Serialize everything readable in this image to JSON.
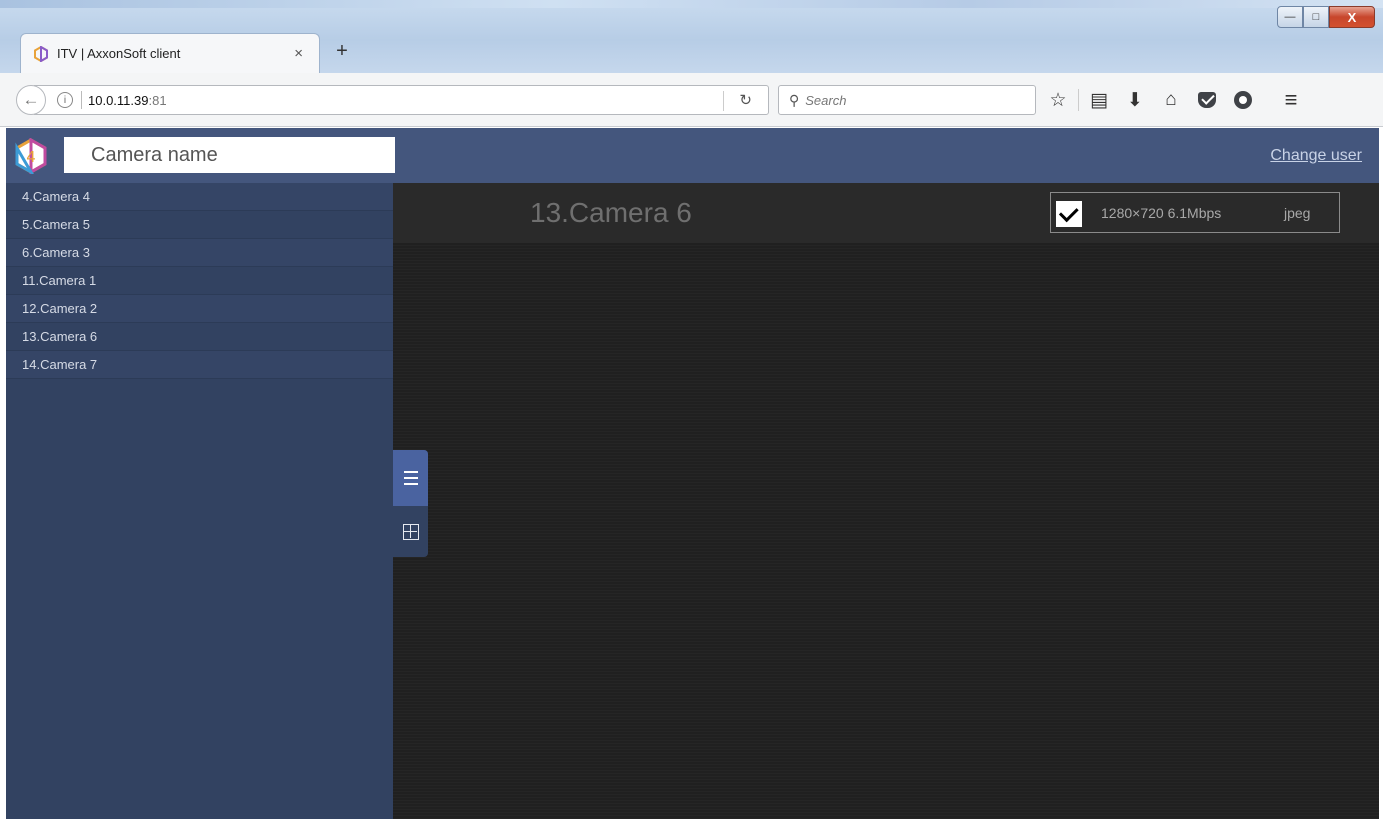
{
  "browser": {
    "tab_title": "ITV | AxxonSoft client",
    "tab_close": "×",
    "new_tab": "+",
    "url_host": "10.0.11.39",
    "url_port": ":81",
    "search_placeholder": "Search",
    "window_controls": {
      "minimize": "—",
      "maximize": "□",
      "close": "X"
    }
  },
  "app": {
    "search": {
      "placeholder": "Camera name",
      "value": ""
    },
    "change_user": "Change user",
    "cameras": [
      "4.Camera 4",
      "5.Camera 5",
      "6.Camera 3",
      "11.Camera 1",
      "12.Camera 2",
      "13.Camera 6",
      "14.Camera 7"
    ],
    "viewer": {
      "camera_title": "13.Camera 6",
      "stream_info": "1280×720 6.1Mbps",
      "codec": "jpeg",
      "stream_checked": true
    },
    "view_modes": [
      "list-icon",
      "grid-icon"
    ]
  },
  "colors": {
    "header_bg": "#44567d",
    "sidebar_bg": "#324261",
    "active_toggle": "#4a63a0",
    "viewer_bg": "#202020"
  }
}
